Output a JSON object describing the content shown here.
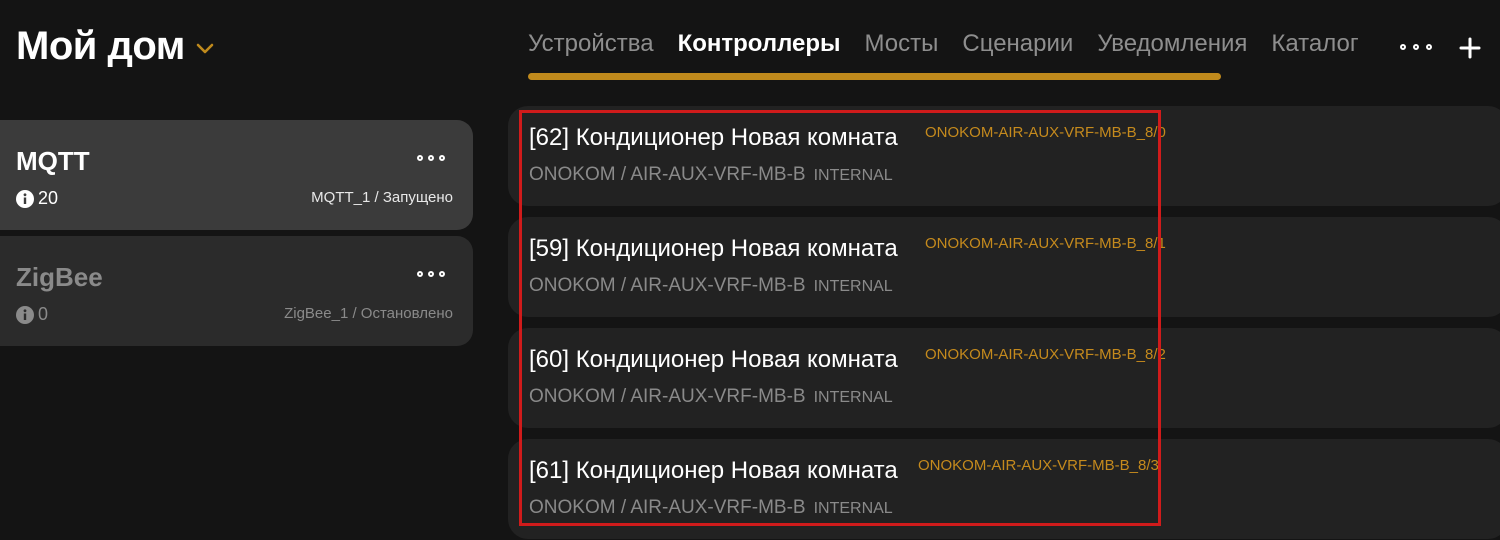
{
  "header": {
    "title": "Мой дом",
    "chevron_icon": "chevron-down-icon",
    "accent": "#c08a1c"
  },
  "tabs": [
    {
      "label": "Устройства",
      "active": false
    },
    {
      "label": "Контроллеры",
      "active": true
    },
    {
      "label": "Мосты",
      "active": false
    },
    {
      "label": "Сценарии",
      "active": false
    },
    {
      "label": "Уведомления",
      "active": false
    },
    {
      "label": "Каталог",
      "active": false
    }
  ],
  "toolbar": {
    "more_icon": "more-horizontal-icon",
    "add_icon": "plus-icon"
  },
  "bridges": [
    {
      "name": "MQTT",
      "count": "20",
      "status": "MQTT_1 / Запущено",
      "selected": true
    },
    {
      "name": "ZigBee",
      "count": "0",
      "status": "ZigBee_1 / Остановлено",
      "selected": false
    }
  ],
  "devices": [
    {
      "title": "[62] Кондиционер Новая комната",
      "id": "ONOKOM-AIR-AUX-VRF-MB-B_8/0",
      "model": "ONOKOM / AIR-AUX-VRF-MB-B",
      "kind": "INTERNAL"
    },
    {
      "title": "[59] Кондиционер Новая комната",
      "id": "ONOKOM-AIR-AUX-VRF-MB-B_8/1",
      "model": "ONOKOM / AIR-AUX-VRF-MB-B",
      "kind": "INTERNAL"
    },
    {
      "title": "[60] Кондиционер Новая комната",
      "id": "ONOKOM-AIR-AUX-VRF-MB-B_8/2",
      "model": "ONOKOM / AIR-AUX-VRF-MB-B",
      "kind": "INTERNAL"
    },
    {
      "title": "[61] Кондиционер Новая комната",
      "id": "ONOKOM-AIR-AUX-VRF-MB-B_8/3",
      "model": "ONOKOM / AIR-AUX-VRF-MB-B",
      "kind": "INTERNAL"
    }
  ],
  "colors": {
    "background": "#141414",
    "card": "#222222",
    "selected_bridge": "#3b3b3b",
    "id_text": "#c58a1d",
    "highlight": "#d01b1b"
  }
}
